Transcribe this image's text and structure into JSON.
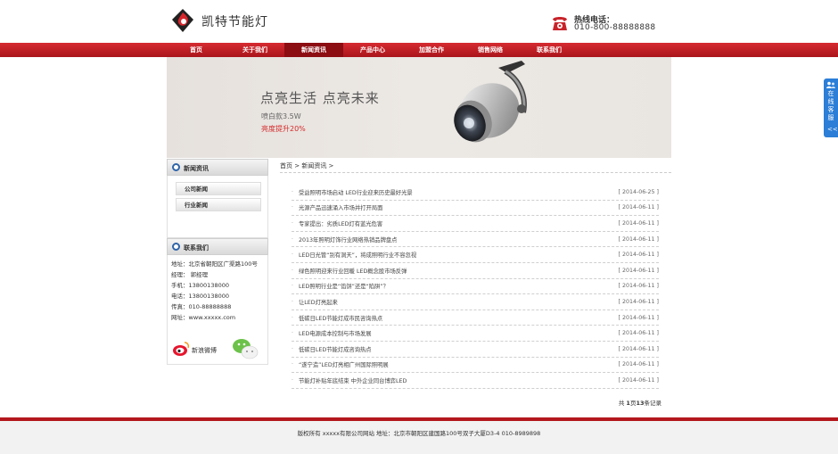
{
  "header": {
    "logo_text": "凯特节能灯",
    "hotline_label": "热线电话：",
    "hotline_number": "010-800-88888888"
  },
  "nav": {
    "items": [
      "首页",
      "关于我们",
      "新闻资讯",
      "产品中心",
      "加盟合作",
      "销售网络",
      "联系我们"
    ],
    "active_index": 2
  },
  "banner": {
    "title": "点亮生活 点亮未来",
    "subtitle": "喷白款3.5W",
    "highlight": "亮度提升20%"
  },
  "sidebar": {
    "news_title": "新闻资讯",
    "links": [
      "公司新闻",
      "行业新闻"
    ],
    "contact_title": "联系我们",
    "contact_lines": [
      "地址：北京省朝阳区广渠路100号",
      "经理： 郭经理",
      "手机：13800138000",
      "电话：13800138000",
      "传真：010-88888888",
      "网址：www.xxxxx.com"
    ],
    "weibo_label": "新浪微博"
  },
  "main": {
    "breadcrumb_home": "首页",
    "breadcrumb_sep": " > ",
    "breadcrumb_current": "新闻资讯",
    "breadcrumb_tail": " >",
    "news": [
      {
        "title": "受益照明市场启动 LED行业迎来历史最好光景",
        "date": "[ 2014-06-25 ]"
      },
      {
        "title": "光源产品迅速涌入市场并打开局面",
        "date": "[ 2014-06-11 ]"
      },
      {
        "title": "专家提出：劣质LED灯有蓝光危害",
        "date": "[ 2014-06-11 ]"
      },
      {
        "title": "2013年照明灯饰行业网络热销品牌盘点",
        "date": "[ 2014-06-11 ]"
      },
      {
        "title": "LED日光管“别有洞天”，将成照明行业不容忽视",
        "date": "[ 2014-06-11 ]"
      },
      {
        "title": "绿色照明迎来行业回暖 LED概念股市场反弹",
        "date": "[ 2014-06-11 ]"
      },
      {
        "title": "LED照明行业是“馅饼”还是“陷阱”？",
        "date": "[ 2014-06-11 ]"
      },
      {
        "title": "让LED灯亮起来",
        "date": "[ 2014-06-11 ]"
      },
      {
        "title": "低碳日LED节能灯成市民咨询热点",
        "date": "[ 2014-06-11 ]"
      },
      {
        "title": "LED电源成本控制与市场发展",
        "date": "[ 2014-06-11 ]"
      },
      {
        "title": "低碳日LED节能灯成咨询热点",
        "date": "[ 2014-06-11 ]"
      },
      {
        "title": "“遂宁造”LED灯亮相广州国际照明展",
        "date": "[ 2014-06-11 ]"
      },
      {
        "title": "节能灯补贴年底结束 中外企业同台博弈LED",
        "date": "[ 2014-06-11 ]"
      }
    ],
    "pager_prefix": "共 ",
    "pager_page": "1",
    "pager_mid": "页",
    "pager_count": "13",
    "pager_suffix": "条记录"
  },
  "float_service": {
    "label": "在线客服",
    "arrow": "<<"
  },
  "footer": {
    "text": "版权所有 xxxxx有限公司网站 地址：北京市朝阳区建国路100号双子大厦D3-4 010-8989898"
  },
  "colors": {
    "brand_red": "#b3171d",
    "nav_active": "#8c0d12",
    "accent_blue": "#2c7ed6"
  }
}
